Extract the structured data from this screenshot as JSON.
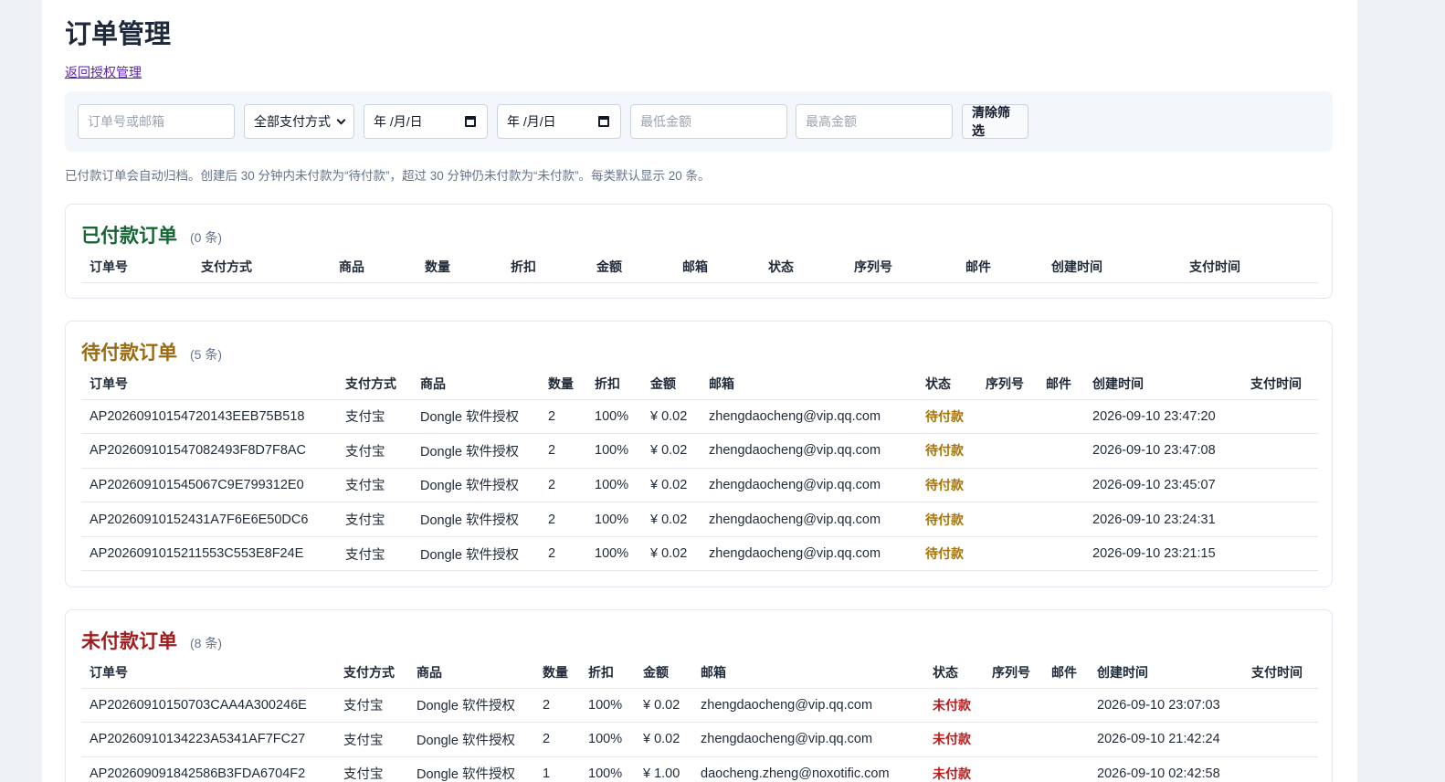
{
  "page": {
    "title": "订单管理",
    "back_link": "返回授权管理",
    "note": "已付款订单会自动归档。创建后 30 分钟内未付款为“待付款”，超过 30 分钟仍未付款为“未付款”。每类默认显示 20 条。"
  },
  "filters": {
    "search_placeholder": "订单号或邮箱",
    "payment_select": "全部支付方式",
    "date_start": "年 /月/日",
    "date_end": "年 /月/日",
    "min_placeholder": "最低金额",
    "max_placeholder": "最高金额",
    "clear_button": "清除筛选"
  },
  "columns": [
    "订单号",
    "支付方式",
    "商品",
    "数量",
    "折扣",
    "金额",
    "邮箱",
    "状态",
    "序列号",
    "邮件",
    "创建时间",
    "支付时间"
  ],
  "paid": {
    "title": "已付款订单",
    "count": "(0 条)"
  },
  "pending": {
    "title": "待付款订单",
    "count": "(5 条)",
    "rows": [
      [
        "AP20260910154720143EEB75B518",
        "支付宝",
        "Dongle 软件授权",
        "2",
        "100%",
        "¥ 0.02",
        "zhengdaocheng@vip.qq.com",
        "待付款",
        "",
        "",
        "2026-09-10 23:47:20",
        ""
      ],
      [
        "AP202609101547082493F8D7F8AC",
        "支付宝",
        "Dongle 软件授权",
        "2",
        "100%",
        "¥ 0.02",
        "zhengdaocheng@vip.qq.com",
        "待付款",
        "",
        "",
        "2026-09-10 23:47:08",
        ""
      ],
      [
        "AP202609101545067C9E799312E0",
        "支付宝",
        "Dongle 软件授权",
        "2",
        "100%",
        "¥ 0.02",
        "zhengdaocheng@vip.qq.com",
        "待付款",
        "",
        "",
        "2026-09-10 23:45:07",
        ""
      ],
      [
        "AP20260910152431A7F6E6E50DC6",
        "支付宝",
        "Dongle 软件授权",
        "2",
        "100%",
        "¥ 0.02",
        "zhengdaocheng@vip.qq.com",
        "待付款",
        "",
        "",
        "2026-09-10 23:24:31",
        ""
      ],
      [
        "AP2026091015211553C553E8F24E",
        "支付宝",
        "Dongle 软件授权",
        "2",
        "100%",
        "¥ 0.02",
        "zhengdaocheng@vip.qq.com",
        "待付款",
        "",
        "",
        "2026-09-10 23:21:15",
        ""
      ]
    ]
  },
  "unpaid": {
    "title": "未付款订单",
    "count": "(8 条)",
    "rows": [
      [
        "AP20260910150703CAA4A300246E",
        "支付宝",
        "Dongle 软件授权",
        "2",
        "100%",
        "¥ 0.02",
        "zhengdaocheng@vip.qq.com",
        "未付款",
        "",
        "",
        "2026-09-10 23:07:03",
        ""
      ],
      [
        "AP20260910134223A5341AF7FC27",
        "支付宝",
        "Dongle 软件授权",
        "2",
        "100%",
        "¥ 0.02",
        "zhengdaocheng@vip.qq.com",
        "未付款",
        "",
        "",
        "2026-09-10 21:42:24",
        ""
      ],
      [
        "AP20260909184258​6B3FDA6704F2",
        "支付宝",
        "Dongle 软件授权",
        "1",
        "100%",
        "¥ 1.00",
        "daocheng.zheng@noxotific.com",
        "未付款",
        "",
        "",
        "2026-09-10 02:42:58",
        ""
      ]
    ]
  }
}
